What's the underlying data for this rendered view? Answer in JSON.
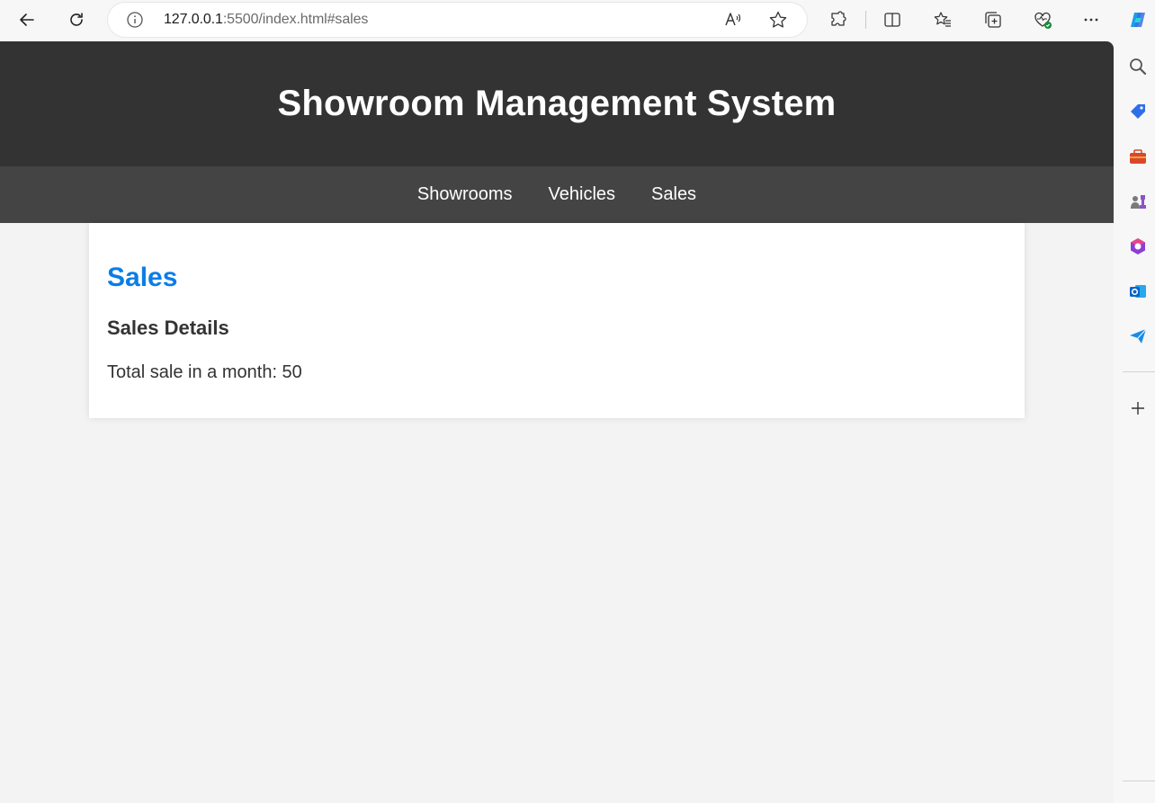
{
  "browser": {
    "url_host": "127.0.0.1",
    "url_rest": ":5500/index.html#sales",
    "icons": {
      "back": "back-arrow-icon",
      "refresh": "refresh-icon",
      "info": "info-icon",
      "read_aloud": "read-aloud-icon",
      "favorite": "star-icon",
      "extensions": "puzzle-icon",
      "split_screen": "split-screen-icon",
      "favorites": "favorites-icon",
      "collections": "collections-icon",
      "browser_essentials": "heart-pulse-icon",
      "more": "more-icon",
      "copilot": "copilot-icon"
    }
  },
  "sidebar": {
    "icons": [
      "search-icon",
      "tag-icon",
      "toolbox-icon",
      "chess-icon",
      "office-icon",
      "outlook-icon",
      "send-icon",
      "add-icon"
    ]
  },
  "site": {
    "title": "Showroom Management System",
    "nav": [
      "Showrooms",
      "Vehicles",
      "Sales"
    ]
  },
  "section": {
    "heading": "Sales",
    "subheading": "Sales Details",
    "detail": "Total sale in a month: 50"
  },
  "colors": {
    "header_bg": "#333333",
    "nav_bg": "#444444",
    "heading_blue": "#0a7de8",
    "page_bg": "#f3f3f3"
  }
}
